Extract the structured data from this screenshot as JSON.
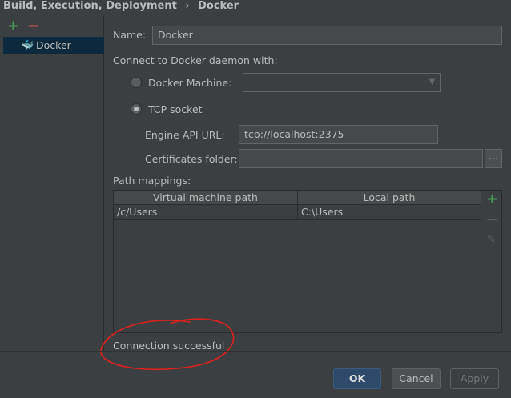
{
  "breadcrumb": {
    "parent": "Build, Execution, Deployment",
    "sep": "›",
    "current": "Docker"
  },
  "sidebar": {
    "add": "+",
    "remove": "−",
    "items": [
      {
        "label": "Docker"
      }
    ]
  },
  "form": {
    "name_label": "Name:",
    "name_value": "Docker",
    "connect_label": "Connect to Docker daemon with:",
    "docker_machine_label": "Docker Machine:",
    "docker_machine_value": "",
    "tcp_label": "TCP socket",
    "engine_label": "Engine API URL:",
    "engine_value": "tcp://localhost:2375",
    "cert_label": "Certificates folder:",
    "cert_value": "",
    "browse": "...",
    "path_mappings_label": "Path mappings:"
  },
  "table": {
    "headers": [
      "Virtual machine path",
      "Local path"
    ],
    "rows": [
      [
        "/c/Users",
        "C:\\Users"
      ]
    ]
  },
  "status": "Connection successful",
  "buttons": {
    "ok": "OK",
    "cancel": "Cancel",
    "apply": "Apply"
  },
  "colors": {
    "add": "#499c54",
    "remove": "#c75450",
    "annotation": "#e0201e"
  }
}
